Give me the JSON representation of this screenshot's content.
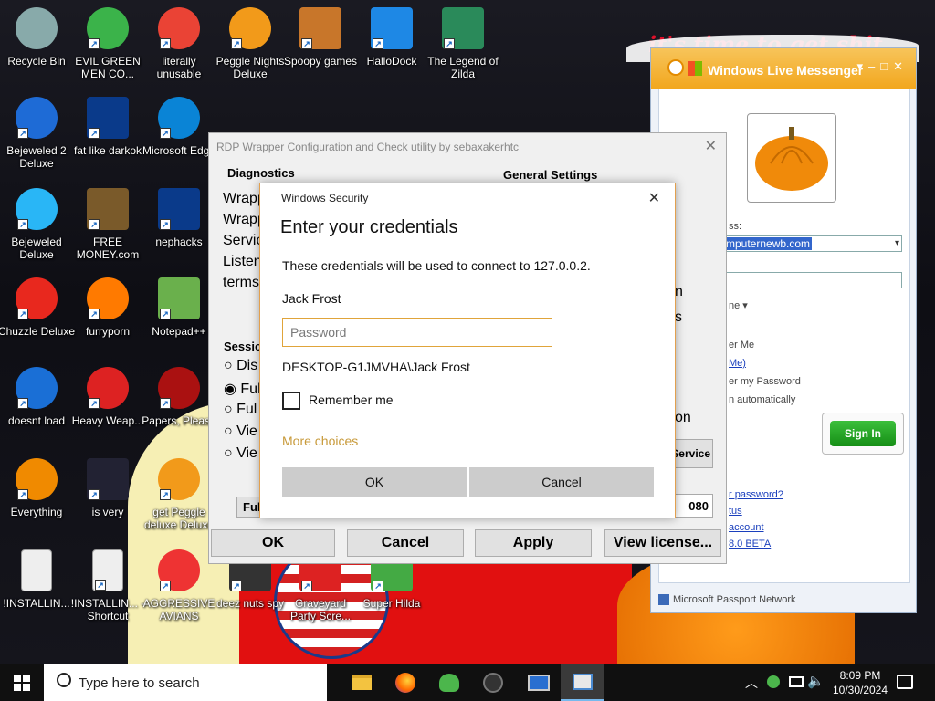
{
  "wallpaper": {
    "scrawl_text": "it's time to get shit"
  },
  "desktop": {
    "icons": [
      {
        "label": "Recycle Bin",
        "glyph": "recycle-bin-icon"
      },
      {
        "label": "EVIL GREEN MEN CO...",
        "glyph": "messenger-people-icon"
      },
      {
        "label": "literally unusable",
        "glyph": "chrome-icon"
      },
      {
        "label": "Peggle Nights Deluxe",
        "glyph": "peggle-icon"
      },
      {
        "label": "Spoopy games",
        "glyph": "folder-icon"
      },
      {
        "label": "HalloDock",
        "glyph": "windows-logo-icon"
      },
      {
        "label": "The Legend of Zilda",
        "glyph": "zelda-character-icon"
      },
      {
        "label": "Bejeweled 2 Deluxe",
        "glyph": "bejeweled-2-icon"
      },
      {
        "label": "fat like darkok",
        "glyph": "mpl-icon"
      },
      {
        "label": "Microsoft Edge",
        "glyph": "edge-icon"
      },
      {
        "label": "Bejeweled Deluxe",
        "glyph": "diamond-icon"
      },
      {
        "label": "FREE MONEY.com",
        "glyph": "money-bag-icon"
      },
      {
        "label": "nephacks",
        "glyph": "mpi-icon"
      },
      {
        "label": "Chuzzle Deluxe",
        "glyph": "chuzzle-icon"
      },
      {
        "label": "furryporn",
        "glyph": "firefox-icon"
      },
      {
        "label": "Notepad++",
        "glyph": "notepad-plus-icon"
      },
      {
        "label": "doesnt load",
        "glyph": "thunderbird-icon"
      },
      {
        "label": "Heavy Weap...",
        "glyph": "radiation-icon"
      },
      {
        "label": "Papers, Please",
        "glyph": "papers-please-icon"
      },
      {
        "label": "Everything",
        "glyph": "magnifier-icon"
      },
      {
        "label": "is very",
        "glyph": "mpl-shield-icon"
      },
      {
        "label": "get Peggle deluxe Deluxe",
        "glyph": "peggle-icon"
      },
      {
        "label": "!INSTALLIN...",
        "glyph": "document-icon"
      },
      {
        "label": "!INSTALLIN... - Shortcut",
        "glyph": "document-icon"
      },
      {
        "label": "AGGRESSIVE AVIANS",
        "glyph": "angry-bird-icon"
      },
      {
        "label": "deez nuts spy",
        "glyph": "spy-icon"
      },
      {
        "label": "Graveyard Party Scre...",
        "glyph": "vote-icon"
      },
      {
        "label": "Super Hilda",
        "glyph": "pixel-icon"
      }
    ]
  },
  "messenger": {
    "title": "Windows Live Messenger",
    "email_label_fragment": "ss:",
    "email_value_fragment": "mputernewb.com",
    "status_fragment": "ne",
    "remember_me": "er Me",
    "remember_me_link": "Me)",
    "remember_password": "er my Password",
    "sign_in_auto": "n automatically",
    "sign_in": "Sign In",
    "forgot_link": "r password?",
    "status_link": "tus",
    "account_link": "account",
    "beta_link": "8.0 BETA",
    "footer": "Microsoft Passport Network"
  },
  "rdp": {
    "title": "RDP Wrapper Configuration and Check utility by sebaxakerhtc",
    "diagnostics_label": "Diagnostics",
    "general_settings_label": "General Settings",
    "diag_lines": [
      "Wrapp",
      "Wrapp",
      "Servic",
      "Listen",
      "terms"
    ],
    "right_fragments": [
      "n",
      "s",
      "on"
    ],
    "session_label": "Sessio",
    "session_options": [
      "Dis",
      "Ful",
      "Ful",
      "Vie",
      "Vie"
    ],
    "bottom_left_fragment": "Ful",
    "service_fragment": "Service",
    "port_fragment": "080",
    "ok": "OK",
    "cancel": "Cancel",
    "apply": "Apply",
    "view_license": "View license..."
  },
  "security": {
    "app_name": "Windows Security",
    "heading": "Enter your credentials",
    "description": "These credentials will be used to connect to 127.0.0.2.",
    "user_name": "Jack Frost",
    "password_placeholder": "Password",
    "domain_user": "DESKTOP-G1JMVHA\\Jack Frost",
    "remember_me": "Remember me",
    "more_choices": "More choices",
    "ok": "OK",
    "cancel": "Cancel",
    "accent_color": "#e0a43a"
  },
  "taskbar": {
    "search_placeholder": "Type here to search",
    "time": "8:09 PM",
    "date": "10/30/2024"
  }
}
